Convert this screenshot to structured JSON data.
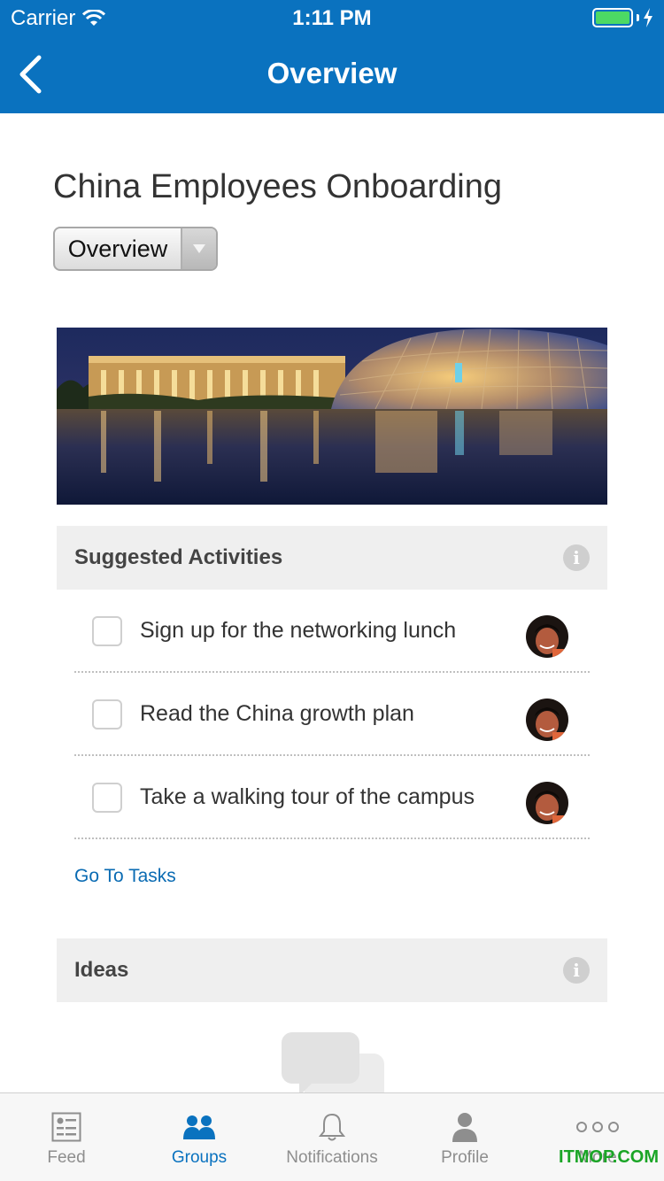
{
  "status_bar": {
    "carrier": "Carrier",
    "time": "1:11 PM"
  },
  "nav": {
    "title": "Overview",
    "back_icon": "chevron-left-icon"
  },
  "group": {
    "title": "China Employees Onboarding",
    "view_selector": "Overview"
  },
  "suggested": {
    "title": "Suggested Activities",
    "items": [
      {
        "label": "Sign up for the networking lunch",
        "checked": false
      },
      {
        "label": "Read the China growth plan",
        "checked": false
      },
      {
        "label": "Take a walking tour of the campus",
        "checked": false
      }
    ],
    "link": "Go To Tasks"
  },
  "ideas": {
    "title": "Ideas"
  },
  "tabs": [
    {
      "label": "Feed",
      "icon": "feed-icon",
      "active": false
    },
    {
      "label": "Groups",
      "icon": "groups-icon",
      "active": true
    },
    {
      "label": "Notifications",
      "icon": "bell-icon",
      "active": false
    },
    {
      "label": "Profile",
      "icon": "profile-icon",
      "active": false
    },
    {
      "label": "More",
      "icon": "more-icon",
      "active": false
    }
  ],
  "watermark": "ITMOP.COM",
  "colors": {
    "brand": "#0a72bf",
    "link": "#0a6bb3",
    "section_bg": "#efefef",
    "battery": "#4cd964"
  }
}
